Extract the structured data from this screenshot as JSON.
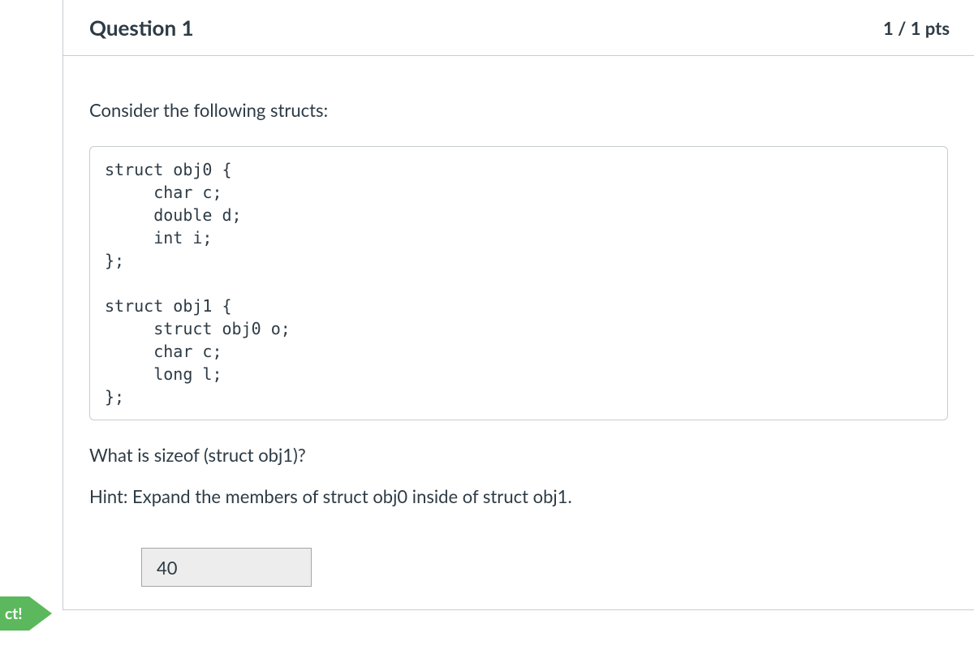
{
  "header": {
    "title": "Question 1",
    "points": "1 / 1 pts"
  },
  "body": {
    "prompt": "Consider the following structs:",
    "code": "struct obj0 {\n     char c;\n     double d;\n     int i;\n};\n\nstruct obj1 {\n     struct obj0 o;\n     char c;\n     long l;\n};",
    "question": "What is sizeof (struct obj1)?",
    "hint": "Hint: Expand the members of struct obj0 inside of struct obj1.",
    "answer": "40"
  },
  "flag": {
    "label": "ct!"
  }
}
